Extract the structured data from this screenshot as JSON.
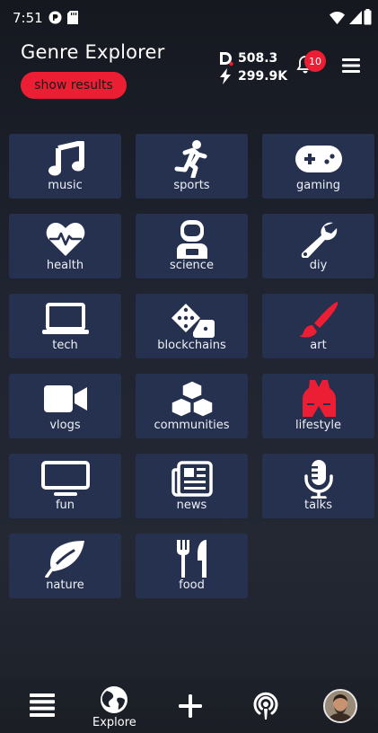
{
  "status": {
    "time": "7:51"
  },
  "header": {
    "title": "Genre Explorer",
    "show_results": "show results"
  },
  "stats": {
    "balance": "508.3",
    "power": "299.9K"
  },
  "notifications": {
    "count": "10"
  },
  "genres": [
    {
      "label": "music",
      "icon": "music-note-icon"
    },
    {
      "label": "sports",
      "icon": "running-person-icon"
    },
    {
      "label": "gaming",
      "icon": "gamepad-icon"
    },
    {
      "label": "health",
      "icon": "heartbeat-icon"
    },
    {
      "label": "science",
      "icon": "astronaut-icon"
    },
    {
      "label": "diy",
      "icon": "wrench-icon"
    },
    {
      "label": "tech",
      "icon": "laptop-icon"
    },
    {
      "label": "blockchains",
      "icon": "dice-icon"
    },
    {
      "label": "art",
      "icon": "paintbrush-icon"
    },
    {
      "label": "vlogs",
      "icon": "video-camera-icon"
    },
    {
      "label": "communities",
      "icon": "cubes-icon"
    },
    {
      "label": "lifestyle",
      "icon": "vest-icon"
    },
    {
      "label": "fun",
      "icon": "tv-icon"
    },
    {
      "label": "news",
      "icon": "newspaper-icon"
    },
    {
      "label": "talks",
      "icon": "microphone-icon"
    },
    {
      "label": "nature",
      "icon": "leaf-icon"
    },
    {
      "label": "food",
      "icon": "utensils-icon"
    }
  ],
  "nav": {
    "explore_label": "Explore"
  },
  "colors": {
    "accent": "#ec1e34",
    "tile": "#25314f",
    "background": "#1f2430"
  }
}
